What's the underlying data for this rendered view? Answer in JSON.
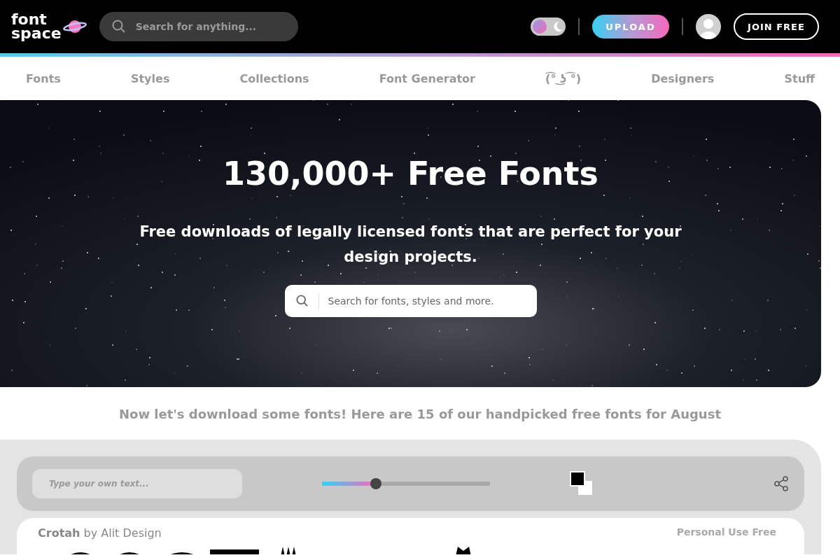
{
  "header": {
    "logo": [
      "font",
      "space"
    ],
    "search": {
      "placeholder": "Search for anything..."
    },
    "dark_mode": {
      "on": false
    },
    "upload": "UPLOAD",
    "join": "JOIN FREE"
  },
  "nav": [
    "Fonts",
    "Styles",
    "Collections",
    "Font Generator",
    "(͡° ͜ʖ ͡°)",
    "Designers",
    "Stuff"
  ],
  "hero": {
    "title": "130,000+ Free Fonts",
    "subtitle": "Free downloads of legally licensed fonts that are perfect for your design projects.",
    "search": {
      "placeholder": "Search for fonts, styles and more."
    }
  },
  "intro": "Now let's download some fonts! Here are 15 of our handpicked free fonts for August",
  "toolbar": {
    "text": {
      "placeholder": "Type your own text..."
    },
    "size": {
      "level": 0.32
    }
  },
  "fonts": [
    {
      "name": "Crotah",
      "by": "by Alit Design",
      "license": "Personal Use Free"
    }
  ]
}
